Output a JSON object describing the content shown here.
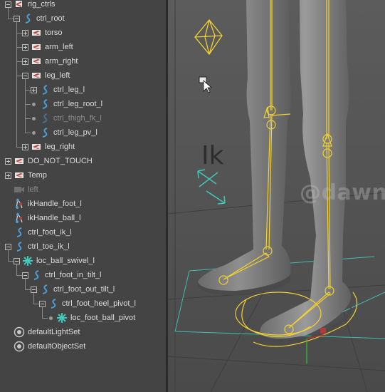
{
  "outliner": {
    "items": [
      {
        "label": "rig_ctrls",
        "icon": "transform-group-icon",
        "expander": "minus",
        "depth": 0,
        "dim": false
      },
      {
        "label": "ctrl_root",
        "icon": "nurbs-curve-icon",
        "expander": "minus",
        "depth": 1,
        "dim": false
      },
      {
        "label": "torso",
        "icon": "joint-icon",
        "expander": "plus",
        "depth": 2,
        "dim": false
      },
      {
        "label": "arm_left",
        "icon": "joint-icon",
        "expander": "plus",
        "depth": 2,
        "dim": false
      },
      {
        "label": "arm_right",
        "icon": "joint-icon",
        "expander": "plus",
        "depth": 2,
        "dim": false
      },
      {
        "label": "leg_left",
        "icon": "joint-icon",
        "expander": "minus",
        "depth": 2,
        "dim": false
      },
      {
        "label": "ctrl_leg_l",
        "icon": "nurbs-curve-icon",
        "expander": "plus",
        "depth": 3,
        "dim": false
      },
      {
        "label": "ctrl_leg_root_l",
        "icon": "nurbs-curve-icon",
        "expander": "dot",
        "depth": 3,
        "dim": false
      },
      {
        "label": "ctrl_thigh_fk_l",
        "icon": "nurbs-curve-icon",
        "expander": "dot",
        "depth": 3,
        "dim": true
      },
      {
        "label": "ctrl_leg_pv_l",
        "icon": "nurbs-curve-icon",
        "expander": "dot",
        "depth": 3,
        "dim": false
      },
      {
        "label": "leg_right",
        "icon": "joint-icon",
        "expander": "plus",
        "depth": 2,
        "dim": false
      },
      {
        "label": "DO_NOT_TOUCH",
        "icon": "joint-icon",
        "expander": "plus",
        "depth": 0,
        "dim": false
      },
      {
        "label": "Temp",
        "icon": "joint-icon",
        "expander": "plus",
        "depth": 0,
        "dim": false
      },
      {
        "label": "left",
        "icon": "camera-icon",
        "expander": "none",
        "depth": 0,
        "dim": true
      },
      {
        "label": "ikHandle_foot_l",
        "icon": "ik-handle-icon",
        "expander": "none",
        "depth": 0,
        "dim": false
      },
      {
        "label": "ikHandle_ball_l",
        "icon": "ik-handle-icon",
        "expander": "none",
        "depth": 0,
        "dim": false
      },
      {
        "label": "ctrl_foot_ik_l",
        "icon": "nurbs-curve-icon",
        "expander": "none",
        "depth": 0,
        "dim": false
      },
      {
        "label": "ctrl_toe_ik_l",
        "icon": "nurbs-curve-icon",
        "expander": "minus",
        "depth": 0,
        "dim": false
      },
      {
        "label": "loc_ball_swivel_l",
        "icon": "locator-icon",
        "expander": "minus",
        "depth": 1,
        "dim": false
      },
      {
        "label": "ctrl_foot_in_tilt_l",
        "icon": "nurbs-curve-icon",
        "expander": "minus",
        "depth": 2,
        "dim": false
      },
      {
        "label": "ctrl_foot_out_tilt_l",
        "icon": "nurbs-curve-icon",
        "expander": "minus",
        "depth": 3,
        "dim": false
      },
      {
        "label": "ctrl_foot_heel_pivot_l",
        "icon": "nurbs-curve-icon",
        "expander": "minus",
        "depth": 4,
        "dim": false
      },
      {
        "label": "loc_foot_ball_pivot",
        "icon": "locator-icon",
        "expander": "dot",
        "depth": 5,
        "dim": false
      },
      {
        "label": "defaultLightSet",
        "icon": "set-icon",
        "expander": "none",
        "depth": 0,
        "dim": false
      },
      {
        "label": "defaultObjectSet",
        "icon": "set-icon",
        "expander": "none",
        "depth": 0,
        "dim": false
      }
    ]
  },
  "viewport": {
    "ik_label": "Ik",
    "watermark": "@dawn_arc"
  },
  "colors": {
    "panel_bg": "#444444",
    "text": "#dcdcdc",
    "text_dim": "#8c8c8c",
    "curve_blue": "#4a9fd8",
    "joint_red": "#b8433c",
    "rig_yellow": "#f2d130",
    "manip_teal": "#3fc9b8",
    "viewport_bg": "#5a5a5a"
  }
}
